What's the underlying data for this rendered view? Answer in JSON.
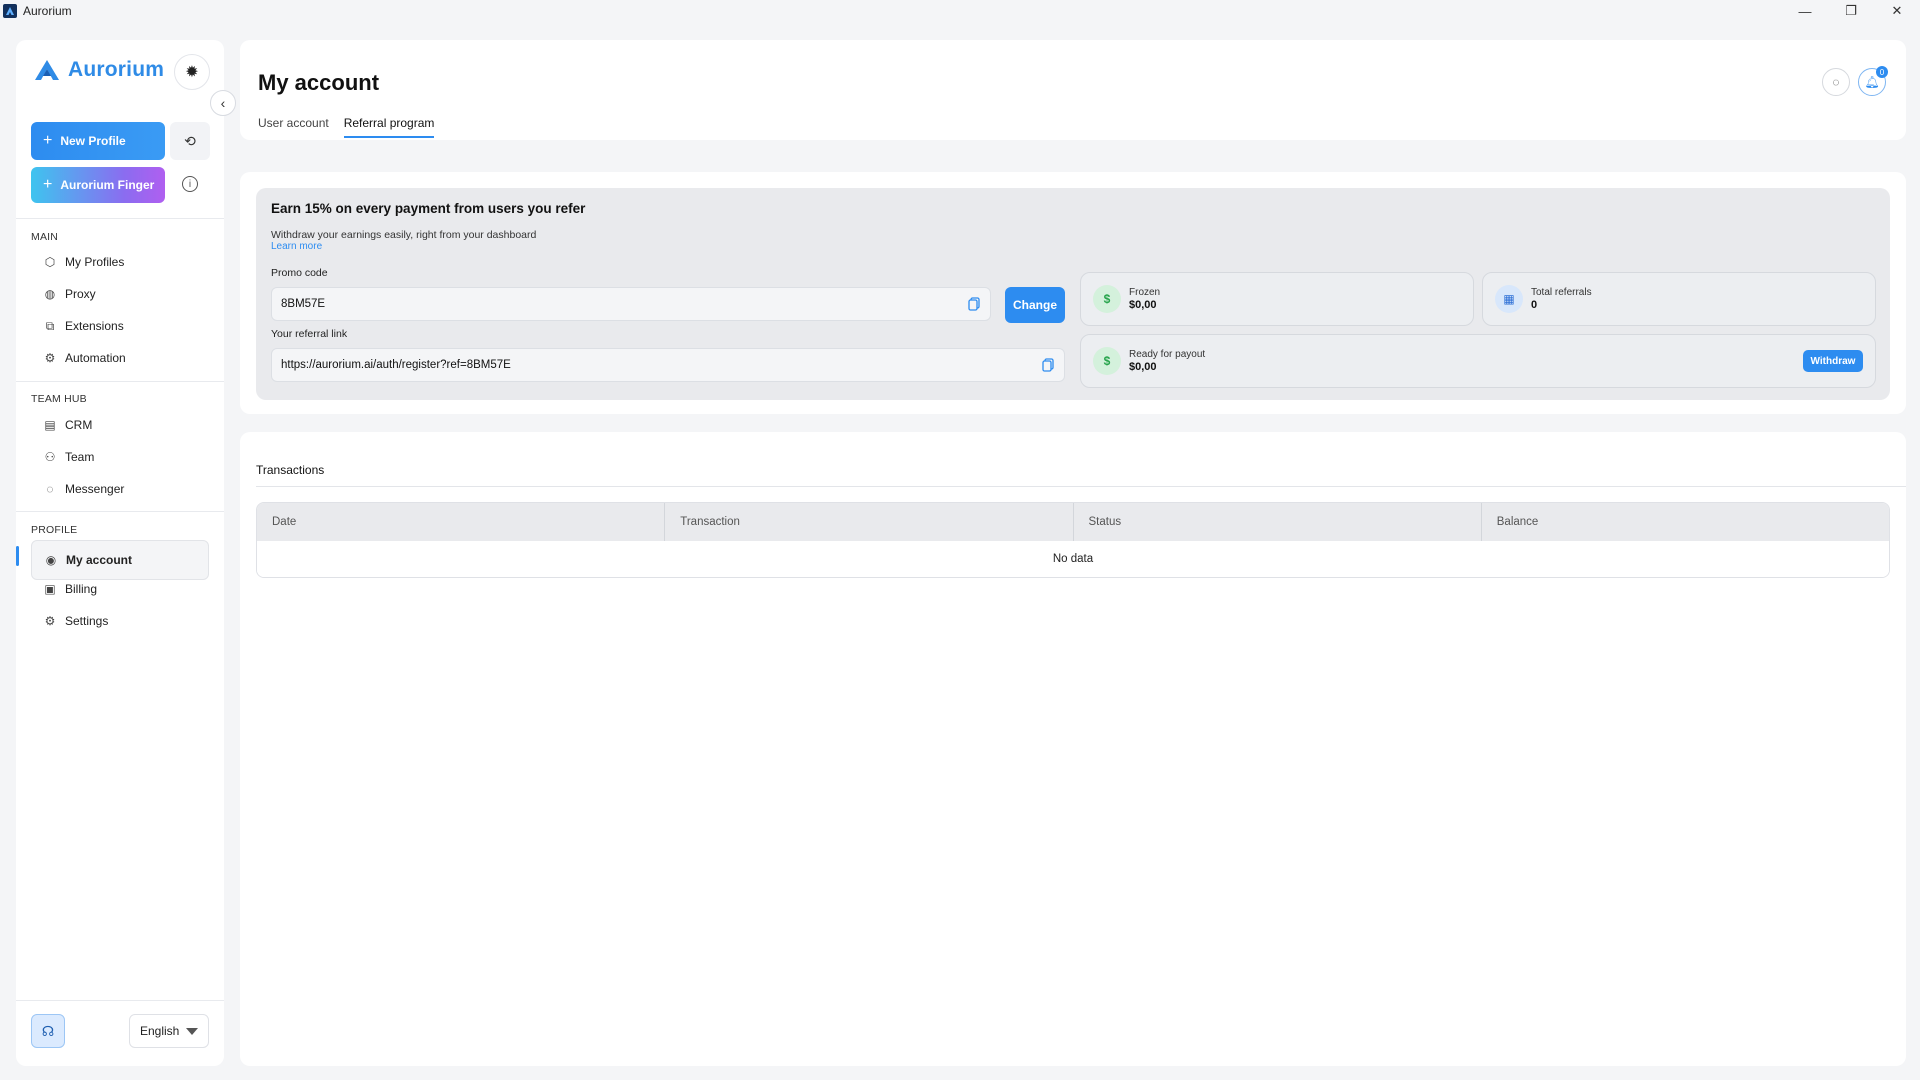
{
  "window": {
    "title": "Aurorium",
    "controls": [
      "minimize-icon",
      "restore-icon",
      "close-icon"
    ]
  },
  "sidebar": {
    "brand": "Aurorium",
    "new_profile_label": "New Profile",
    "finger_label": "Aurorium Finger",
    "sections": {
      "main": "MAIN",
      "team_hub": "TEAM HUB",
      "profile": "PROFILE"
    },
    "main_items": [
      {
        "label": "My Profiles",
        "icon": "box-icon"
      },
      {
        "label": "Proxy",
        "icon": "globe-icon"
      },
      {
        "label": "Extensions",
        "icon": "puzzle-icon"
      },
      {
        "label": "Automation",
        "icon": "automation-icon"
      }
    ],
    "team_items": [
      {
        "label": "CRM",
        "icon": "crm-icon"
      },
      {
        "label": "Team",
        "icon": "team-icon"
      },
      {
        "label": "Messenger",
        "icon": "chat-icon"
      }
    ],
    "profile_items": [
      {
        "label": "My account",
        "icon": "user-circle-icon",
        "active": true
      },
      {
        "label": "Billing",
        "icon": "wallet-icon"
      },
      {
        "label": "Settings",
        "icon": "gear-icon"
      }
    ],
    "language": "English"
  },
  "header": {
    "title": "My account",
    "tabs": [
      {
        "label": "User account",
        "active": false
      },
      {
        "label": "Referral program",
        "active": true
      }
    ],
    "notification_count": "0"
  },
  "referral": {
    "headline": "Earn 15% on every payment from users you refer",
    "subtitle": "Withdraw your earnings easily, right from your dashboard",
    "learn_more": "Learn more",
    "promo_label": "Promo code",
    "promo_value": "8BM57E",
    "change_label": "Change",
    "link_label": "Your referral link",
    "link_value": "https://aurorium.ai/auth/register?ref=8BM57E",
    "stats": {
      "frozen_label": "Frozen",
      "frozen_value": "$0,00",
      "total_referrals_label": "Total referrals",
      "total_referrals_value": "0",
      "ready_label": "Ready for payout",
      "ready_value": "$0,00",
      "withdraw_label": "Withdraw"
    }
  },
  "transactions": {
    "title": "Transactions",
    "columns": [
      "Date",
      "Transaction",
      "Status",
      "Balance"
    ],
    "empty": "No data"
  },
  "colors": {
    "accent": "#2d8cf0",
    "brand": "#2f8be6"
  }
}
